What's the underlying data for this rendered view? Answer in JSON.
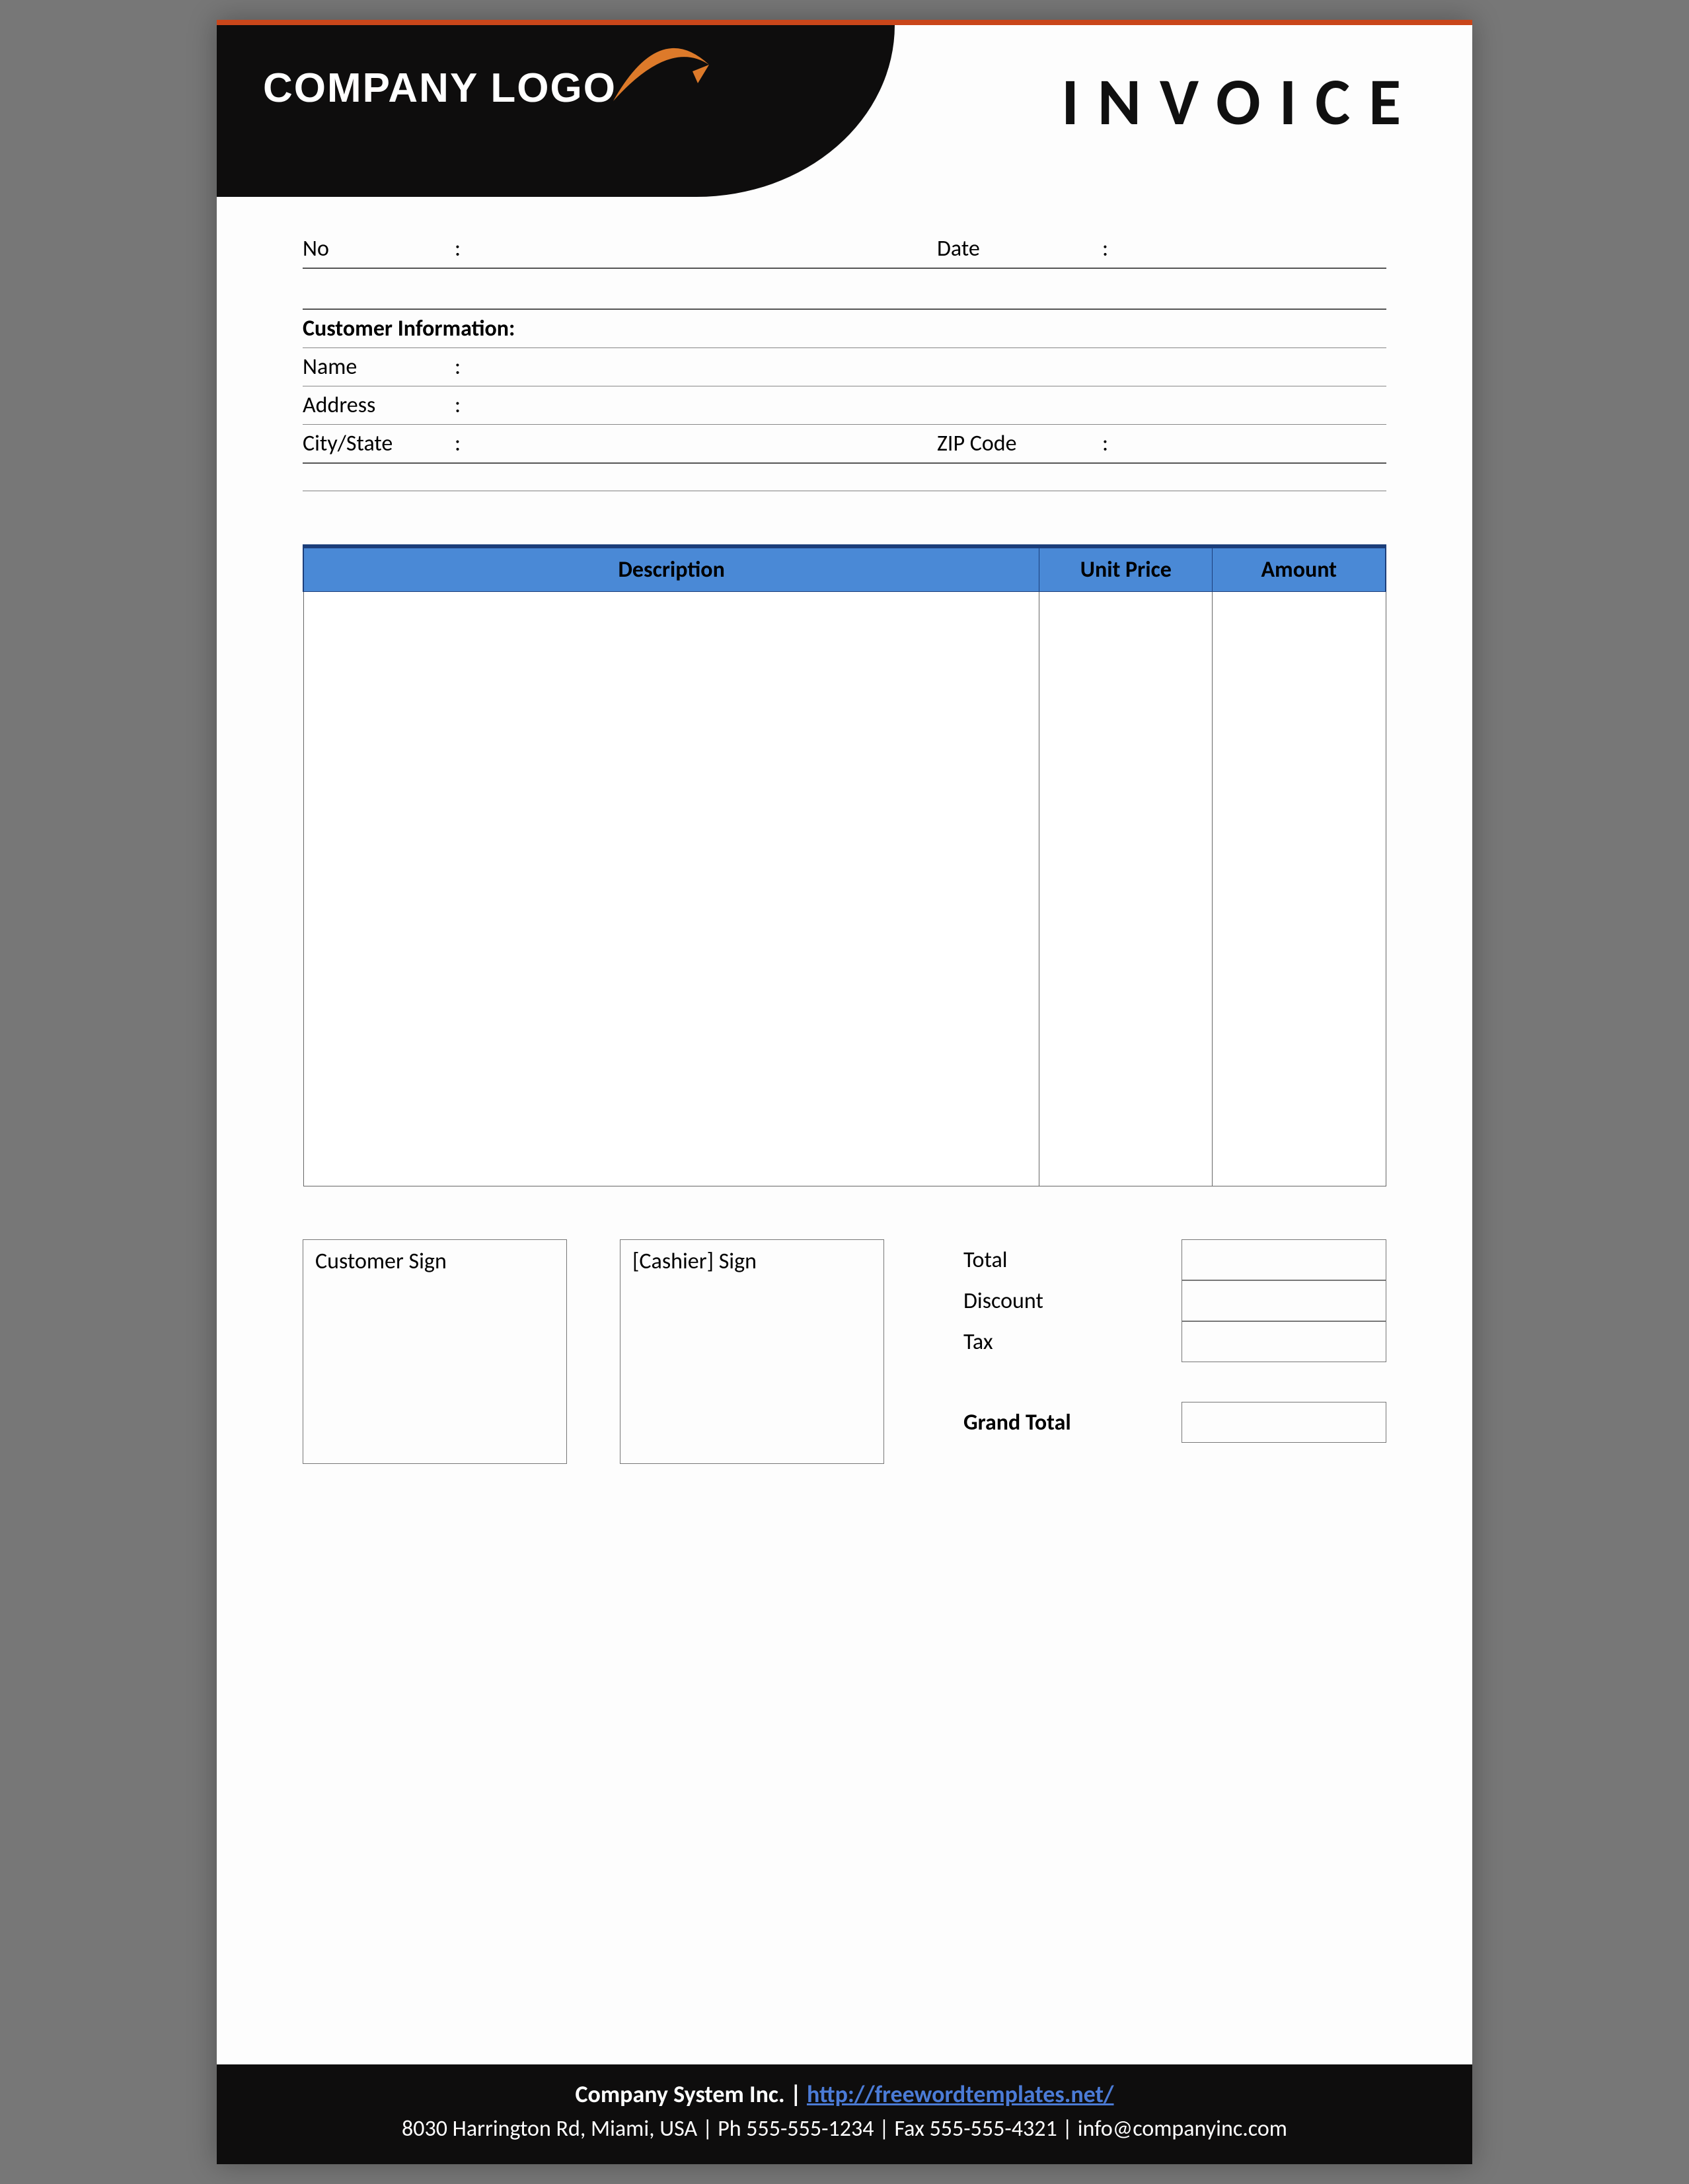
{
  "header": {
    "logo_text": "COMPANY LOGO",
    "title": "INVOICE"
  },
  "meta": {
    "no_label": "No",
    "date_label": "Date",
    "no_value": "",
    "date_value": ""
  },
  "customer": {
    "section_title": "Customer Information:",
    "name_label": "Name",
    "address_label": "Address",
    "citystate_label": "City/State",
    "zip_label": "ZIP Code",
    "name_value": "",
    "address_value": "",
    "citystate_value": "",
    "zip_value": ""
  },
  "table": {
    "headers": {
      "description": "Description",
      "unit_price": "Unit Price",
      "amount": "Amount"
    }
  },
  "signatures": {
    "customer": "Customer Sign",
    "cashier": "[Cashier] Sign"
  },
  "totals": {
    "total": "Total",
    "discount": "Discount",
    "tax": "Tax",
    "grand_total": "Grand Total"
  },
  "footer": {
    "company": "Company System Inc.",
    "sep": " | ",
    "url": "http://freewordtemplates.net/",
    "line2": "8030 Harrington Rd, Miami, USA | Ph 555-555-1234 | Fax 555-555-4321 | info@companyinc.com"
  },
  "colors": {
    "accent_orange": "#dd7a2a",
    "header_blue": "#4a89d6",
    "header_blue_dark": "#1c3e7a"
  }
}
